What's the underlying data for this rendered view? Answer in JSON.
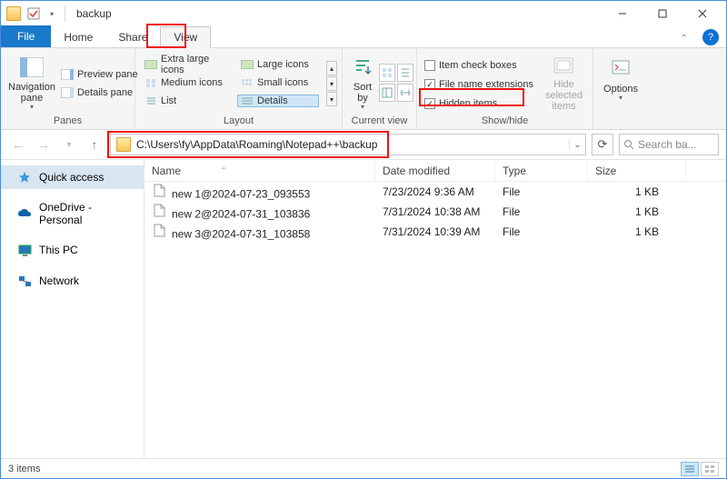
{
  "window": {
    "title": "backup"
  },
  "tabs": {
    "file": "File",
    "home": "Home",
    "share": "Share",
    "view": "View"
  },
  "ribbon": {
    "panes": {
      "label": "Panes",
      "navigation": "Navigation pane",
      "preview": "Preview pane",
      "details": "Details pane"
    },
    "layout": {
      "label": "Layout",
      "xl": "Extra large icons",
      "l": "Large icons",
      "m": "Medium icons",
      "s": "Small icons",
      "list": "List",
      "details": "Details"
    },
    "current_view": {
      "label": "Current view",
      "sort": "Sort by"
    },
    "showhide": {
      "label": "Show/hide",
      "checkboxes": "Item check boxes",
      "ext": "File name extensions",
      "hidden": "Hidden items",
      "hide_selected": "Hide selected items",
      "checkboxes_on": false,
      "ext_on": true,
      "hidden_on": true
    },
    "options": "Options"
  },
  "address": {
    "path": "C:\\Users\\fy\\AppData\\Roaming\\Notepad++\\backup"
  },
  "search": {
    "placeholder": "Search ba..."
  },
  "sidebar": {
    "items": [
      {
        "label": "Quick access",
        "icon": "star-icon",
        "selected": true
      },
      {
        "label": "OneDrive - Personal",
        "icon": "cloud-icon",
        "selected": false
      },
      {
        "label": "This PC",
        "icon": "pc-icon",
        "selected": false
      },
      {
        "label": "Network",
        "icon": "network-icon",
        "selected": false
      }
    ]
  },
  "columns": {
    "name": "Name",
    "date": "Date modified",
    "type": "Type",
    "size": "Size"
  },
  "files": [
    {
      "name": "new 1@2024-07-23_093553",
      "date": "7/23/2024 9:36 AM",
      "type": "File",
      "size": "1 KB"
    },
    {
      "name": "new 2@2024-07-31_103836",
      "date": "7/31/2024 10:38 AM",
      "type": "File",
      "size": "1 KB"
    },
    {
      "name": "new 3@2024-07-31_103858",
      "date": "7/31/2024 10:39 AM",
      "type": "File",
      "size": "1 KB"
    }
  ],
  "status": {
    "text": "3 items"
  }
}
